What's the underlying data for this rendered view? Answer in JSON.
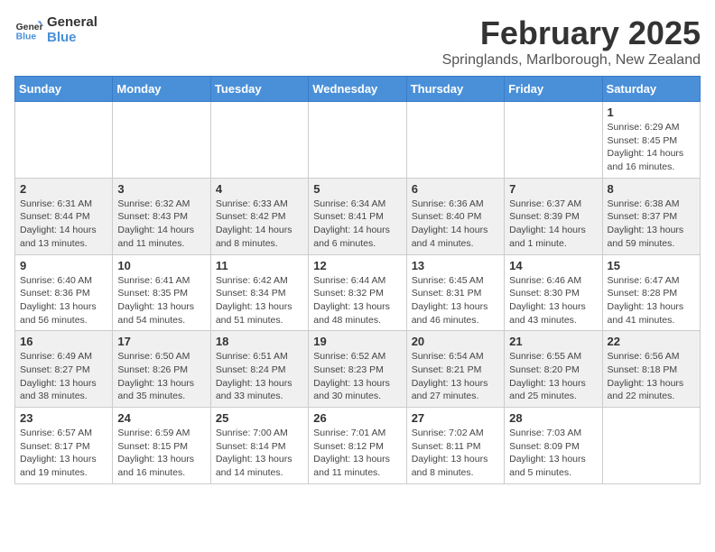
{
  "logo": {
    "text_general": "General",
    "text_blue": "Blue"
  },
  "title": "February 2025",
  "location": "Springlands, Marlborough, New Zealand",
  "days_of_week": [
    "Sunday",
    "Monday",
    "Tuesday",
    "Wednesday",
    "Thursday",
    "Friday",
    "Saturday"
  ],
  "weeks": [
    [
      {
        "day": "",
        "info": ""
      },
      {
        "day": "",
        "info": ""
      },
      {
        "day": "",
        "info": ""
      },
      {
        "day": "",
        "info": ""
      },
      {
        "day": "",
        "info": ""
      },
      {
        "day": "",
        "info": ""
      },
      {
        "day": "1",
        "info": "Sunrise: 6:29 AM\nSunset: 8:45 PM\nDaylight: 14 hours and 16 minutes."
      }
    ],
    [
      {
        "day": "2",
        "info": "Sunrise: 6:31 AM\nSunset: 8:44 PM\nDaylight: 14 hours and 13 minutes."
      },
      {
        "day": "3",
        "info": "Sunrise: 6:32 AM\nSunset: 8:43 PM\nDaylight: 14 hours and 11 minutes."
      },
      {
        "day": "4",
        "info": "Sunrise: 6:33 AM\nSunset: 8:42 PM\nDaylight: 14 hours and 8 minutes."
      },
      {
        "day": "5",
        "info": "Sunrise: 6:34 AM\nSunset: 8:41 PM\nDaylight: 14 hours and 6 minutes."
      },
      {
        "day": "6",
        "info": "Sunrise: 6:36 AM\nSunset: 8:40 PM\nDaylight: 14 hours and 4 minutes."
      },
      {
        "day": "7",
        "info": "Sunrise: 6:37 AM\nSunset: 8:39 PM\nDaylight: 14 hours and 1 minute."
      },
      {
        "day": "8",
        "info": "Sunrise: 6:38 AM\nSunset: 8:37 PM\nDaylight: 13 hours and 59 minutes."
      }
    ],
    [
      {
        "day": "9",
        "info": "Sunrise: 6:40 AM\nSunset: 8:36 PM\nDaylight: 13 hours and 56 minutes."
      },
      {
        "day": "10",
        "info": "Sunrise: 6:41 AM\nSunset: 8:35 PM\nDaylight: 13 hours and 54 minutes."
      },
      {
        "day": "11",
        "info": "Sunrise: 6:42 AM\nSunset: 8:34 PM\nDaylight: 13 hours and 51 minutes."
      },
      {
        "day": "12",
        "info": "Sunrise: 6:44 AM\nSunset: 8:32 PM\nDaylight: 13 hours and 48 minutes."
      },
      {
        "day": "13",
        "info": "Sunrise: 6:45 AM\nSunset: 8:31 PM\nDaylight: 13 hours and 46 minutes."
      },
      {
        "day": "14",
        "info": "Sunrise: 6:46 AM\nSunset: 8:30 PM\nDaylight: 13 hours and 43 minutes."
      },
      {
        "day": "15",
        "info": "Sunrise: 6:47 AM\nSunset: 8:28 PM\nDaylight: 13 hours and 41 minutes."
      }
    ],
    [
      {
        "day": "16",
        "info": "Sunrise: 6:49 AM\nSunset: 8:27 PM\nDaylight: 13 hours and 38 minutes."
      },
      {
        "day": "17",
        "info": "Sunrise: 6:50 AM\nSunset: 8:26 PM\nDaylight: 13 hours and 35 minutes."
      },
      {
        "day": "18",
        "info": "Sunrise: 6:51 AM\nSunset: 8:24 PM\nDaylight: 13 hours and 33 minutes."
      },
      {
        "day": "19",
        "info": "Sunrise: 6:52 AM\nSunset: 8:23 PM\nDaylight: 13 hours and 30 minutes."
      },
      {
        "day": "20",
        "info": "Sunrise: 6:54 AM\nSunset: 8:21 PM\nDaylight: 13 hours and 27 minutes."
      },
      {
        "day": "21",
        "info": "Sunrise: 6:55 AM\nSunset: 8:20 PM\nDaylight: 13 hours and 25 minutes."
      },
      {
        "day": "22",
        "info": "Sunrise: 6:56 AM\nSunset: 8:18 PM\nDaylight: 13 hours and 22 minutes."
      }
    ],
    [
      {
        "day": "23",
        "info": "Sunrise: 6:57 AM\nSunset: 8:17 PM\nDaylight: 13 hours and 19 minutes."
      },
      {
        "day": "24",
        "info": "Sunrise: 6:59 AM\nSunset: 8:15 PM\nDaylight: 13 hours and 16 minutes."
      },
      {
        "day": "25",
        "info": "Sunrise: 7:00 AM\nSunset: 8:14 PM\nDaylight: 13 hours and 14 minutes."
      },
      {
        "day": "26",
        "info": "Sunrise: 7:01 AM\nSunset: 8:12 PM\nDaylight: 13 hours and 11 minutes."
      },
      {
        "day": "27",
        "info": "Sunrise: 7:02 AM\nSunset: 8:11 PM\nDaylight: 13 hours and 8 minutes."
      },
      {
        "day": "28",
        "info": "Sunrise: 7:03 AM\nSunset: 8:09 PM\nDaylight: 13 hours and 5 minutes."
      },
      {
        "day": "",
        "info": ""
      }
    ]
  ]
}
